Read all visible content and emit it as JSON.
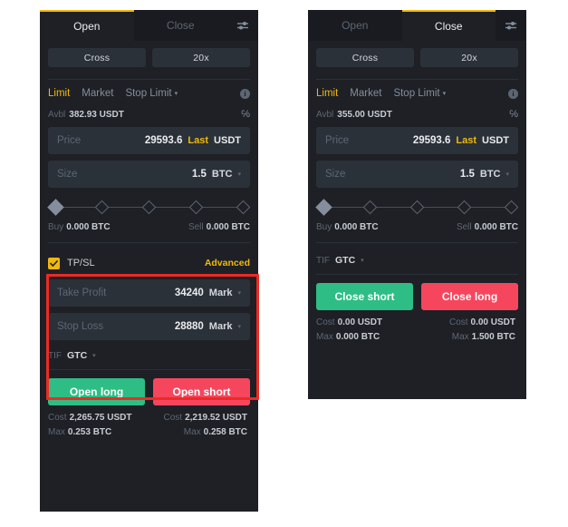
{
  "panels": {
    "left": {
      "tabs": [
        {
          "label": "Open",
          "active": true
        },
        {
          "label": "Close",
          "active": false
        }
      ],
      "settings_icon": "sliders-icon",
      "margin_mode": "Cross",
      "leverage": "20x",
      "order_types": [
        {
          "label": "Limit",
          "active": true
        },
        {
          "label": "Market",
          "active": false
        },
        {
          "label": "Stop Limit",
          "active": false,
          "caret": "▾"
        }
      ],
      "info_icon": "info-icon",
      "avbl_label": "Avbl",
      "avbl_value": "382.93 USDT",
      "pct_icon": "percent-transfer-icon",
      "price": {
        "label": "Price",
        "value": "29593.6",
        "tag": "Last",
        "unit": "USDT"
      },
      "size": {
        "label": "Size",
        "value": "1.5",
        "unit": "BTC",
        "caret": "▾"
      },
      "slider": {
        "positions": [
          0,
          25,
          50,
          75,
          100
        ],
        "value": 0
      },
      "buy": {
        "label": "Buy",
        "value": "0.000 BTC"
      },
      "sell": {
        "label": "Sell",
        "value": "0.000 BTC"
      },
      "tpsl": {
        "checked": true,
        "label": "TP/SL",
        "advanced": "Advanced",
        "take_profit": {
          "label": "Take Profit",
          "value": "34240",
          "ref": "Mark",
          "caret": "▾"
        },
        "stop_loss": {
          "label": "Stop Loss",
          "value": "28880",
          "ref": "Mark",
          "caret": "▾"
        }
      },
      "tif": {
        "label": "TIF",
        "value": "GTC",
        "caret": "▾"
      },
      "actions": [
        {
          "label": "Open long",
          "color": "green"
        },
        {
          "label": "Open short",
          "color": "red"
        }
      ],
      "summary": {
        "cost_label": "Cost",
        "max_label": "Max",
        "long_cost": "2,265.75 USDT",
        "short_cost": "2,219.52 USDT",
        "long_max": "0.253 BTC",
        "short_max": "0.258 BTC"
      }
    },
    "right": {
      "tabs": [
        {
          "label": "Open",
          "active": false
        },
        {
          "label": "Close",
          "active": true
        }
      ],
      "settings_icon": "sliders-icon",
      "margin_mode": "Cross",
      "leverage": "20x",
      "order_types": [
        {
          "label": "Limit",
          "active": true
        },
        {
          "label": "Market",
          "active": false
        },
        {
          "label": "Stop Limit",
          "active": false,
          "caret": "▾"
        }
      ],
      "info_icon": "info-icon",
      "avbl_label": "Avbl",
      "avbl_value": "355.00 USDT",
      "pct_icon": "percent-transfer-icon",
      "price": {
        "label": "Price",
        "value": "29593.6",
        "tag": "Last",
        "unit": "USDT"
      },
      "size": {
        "label": "Size",
        "value": "1.5",
        "unit": "BTC",
        "caret": "▾"
      },
      "slider": {
        "positions": [
          0,
          25,
          50,
          75,
          100
        ],
        "value": 0
      },
      "buy": {
        "label": "Buy",
        "value": "0.000 BTC"
      },
      "sell": {
        "label": "Sell",
        "value": "0.000 BTC"
      },
      "tif": {
        "label": "TIF",
        "value": "GTC",
        "caret": "▾"
      },
      "actions": [
        {
          "label": "Close short",
          "color": "green"
        },
        {
          "label": "Close long",
          "color": "red"
        }
      ],
      "summary": {
        "cost_label": "Cost",
        "max_label": "Max",
        "long_cost": "0.00 USDT",
        "short_cost": "0.00 USDT",
        "long_max": "0.000 BTC",
        "short_max": "1.500 BTC"
      }
    }
  },
  "annotation": {
    "type": "highlight-rectangle",
    "color": "#ee2a23",
    "target": "tpsl-section"
  },
  "colors": {
    "panel_bg": "#1e2026",
    "tab_bg": "#191b20",
    "field_bg": "#2b3139",
    "accent": "#f0b90b",
    "green": "#2ebd85",
    "red": "#f6465d",
    "text_primary": "#eaecef",
    "text_muted": "#5e6673",
    "annotation": "#ee2a23"
  }
}
